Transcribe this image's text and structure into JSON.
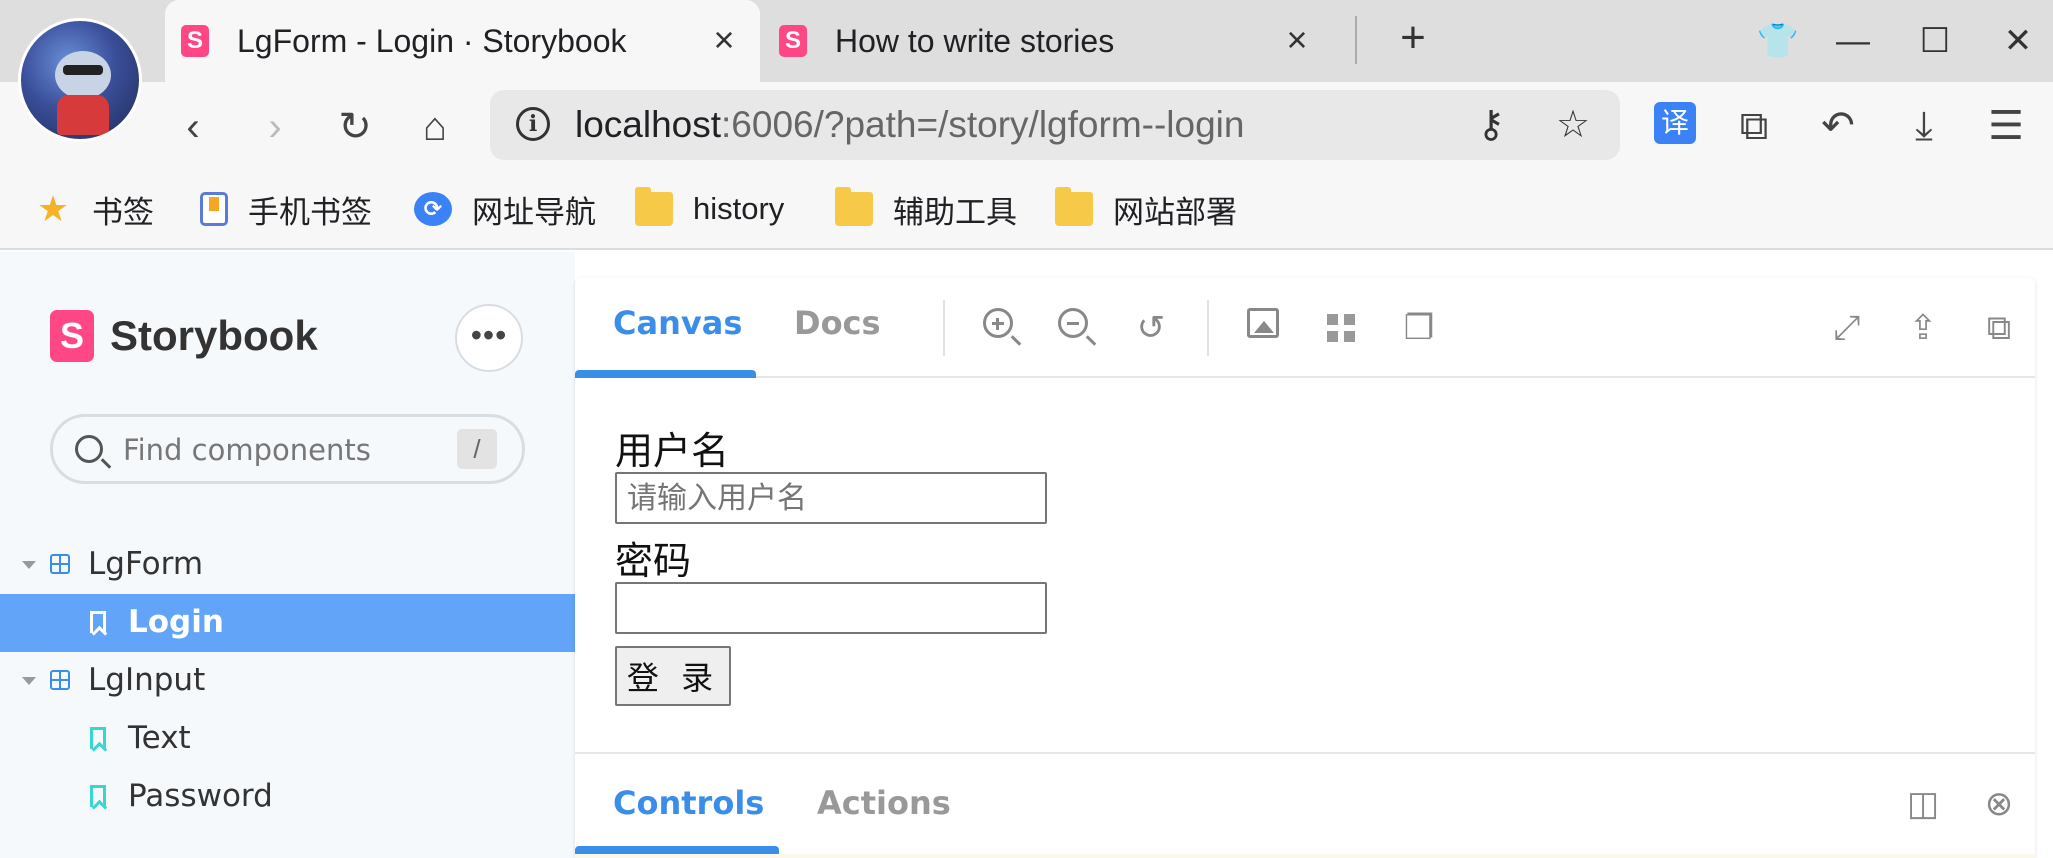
{
  "browser": {
    "tabs": [
      {
        "title": "LgForm - Login · Storybook",
        "close": "×"
      },
      {
        "title": "How to write stories",
        "close": "×"
      }
    ],
    "new_tab": "+",
    "window_controls": {
      "minimize": "—",
      "maximize": "☐",
      "close": "✕"
    },
    "nav": {
      "back": "‹",
      "forward": "›",
      "reload": "↻",
      "home": "⌂"
    },
    "url": {
      "host": "localhost",
      "rest": ":6006/?path=/story/lgform--login"
    },
    "icons": {
      "info": "i",
      "key": "⚷",
      "star": "☆",
      "translate": "译",
      "extensions": "⧉",
      "undo": "↶",
      "download": "⤓",
      "menu": "☰",
      "shirt": "👕"
    },
    "bookmarks": [
      {
        "label": "书签",
        "icon": "star-icon"
      },
      {
        "label": "手机书签",
        "icon": "phone-icon"
      },
      {
        "label": "网址导航",
        "icon": "nav-icon"
      },
      {
        "label": "history",
        "icon": "folder-icon"
      },
      {
        "label": "辅助工具",
        "icon": "folder-icon"
      },
      {
        "label": "网站部署",
        "icon": "folder-icon"
      }
    ]
  },
  "storybook": {
    "brand": "Storybook",
    "brand_logo": "S",
    "menu_glyph": "•••",
    "search": {
      "placeholder": "Find components",
      "shortcut": "/"
    },
    "tree": [
      {
        "label": "LgForm",
        "stories": [
          "Login"
        ]
      },
      {
        "label": "LgInput",
        "stories": [
          "Text",
          "Password"
        ]
      }
    ],
    "selected_story": "Login",
    "toolbar": {
      "tabs": [
        "Canvas",
        "Docs"
      ],
      "active_tab": "Canvas",
      "tools": [
        "zoom-in-icon",
        "zoom-out-icon",
        "zoom-reset-icon",
        "background-icon",
        "grid-icon",
        "outline-icon",
        "fullscreen-icon",
        "share-icon",
        "copy-icon"
      ]
    },
    "canvas": {
      "username_label": "用户名",
      "username_placeholder": "请输入用户名",
      "username_value": "",
      "password_label": "密码",
      "password_value": "",
      "submit_label": "登 录"
    },
    "addons": {
      "tabs": [
        "Controls",
        "Actions"
      ],
      "active_tab": "Controls"
    }
  },
  "colors": {
    "accent": "#3b8ee8",
    "selection": "#62a4f8",
    "storybook_pink": "#ff4785",
    "story_icon": "#37d5d3"
  }
}
